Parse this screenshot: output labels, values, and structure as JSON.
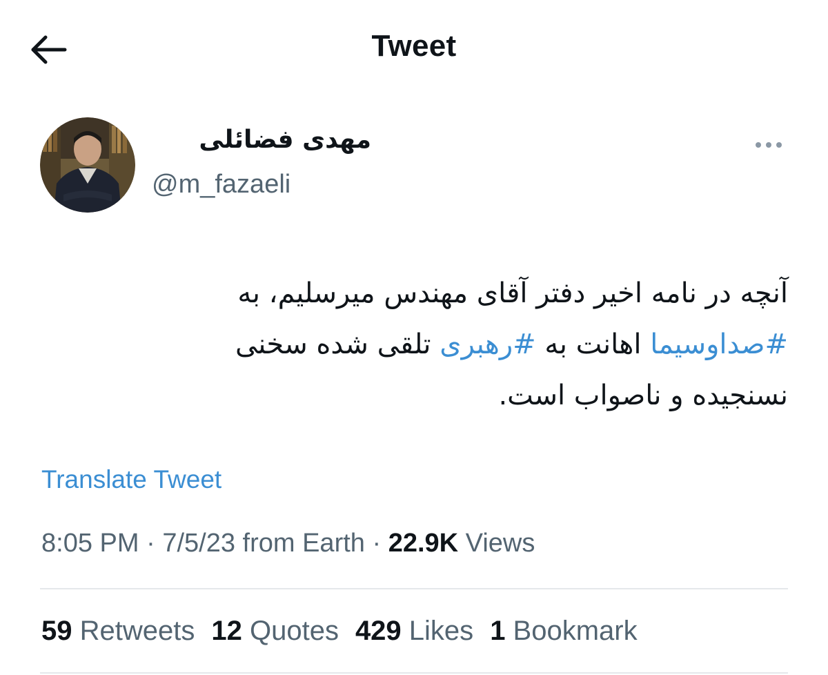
{
  "header": {
    "title": "Tweet",
    "back_icon": "arrow-left-icon"
  },
  "author": {
    "display_name": "مهدی فضائلی",
    "handle": "@m_fazaeli",
    "more_icon": "more-horizontal-icon"
  },
  "tweet": {
    "line1": "آنچه در نامه اخیر دفتر آقای مهندس میرسلیم، به",
    "hashtag1": "#صداوسیما",
    "mid1": " اهانت به ",
    "hashtag2": "#رهبری",
    "mid2": " تلقی شده سخنی",
    "line3": "نسنجیده و ناصواب است.",
    "translate_label": "Translate Tweet"
  },
  "meta": {
    "time": "8:05 PM",
    "sep1": " · ",
    "date": "7/5/23",
    "source": " from Earth",
    "sep2": " · ",
    "views_count": "22.9K",
    "views_label": " Views"
  },
  "stats": [
    {
      "count": "59",
      "label": " Retweets"
    },
    {
      "count": "12",
      "label": " Quotes"
    },
    {
      "count": "429",
      "label": " Likes"
    },
    {
      "count": "1",
      "label": " Bookmark"
    }
  ],
  "colors": {
    "link": "#3b8ed3",
    "text_primary": "#0f1419",
    "text_secondary": "#536471",
    "divider": "#e5e8eb"
  }
}
